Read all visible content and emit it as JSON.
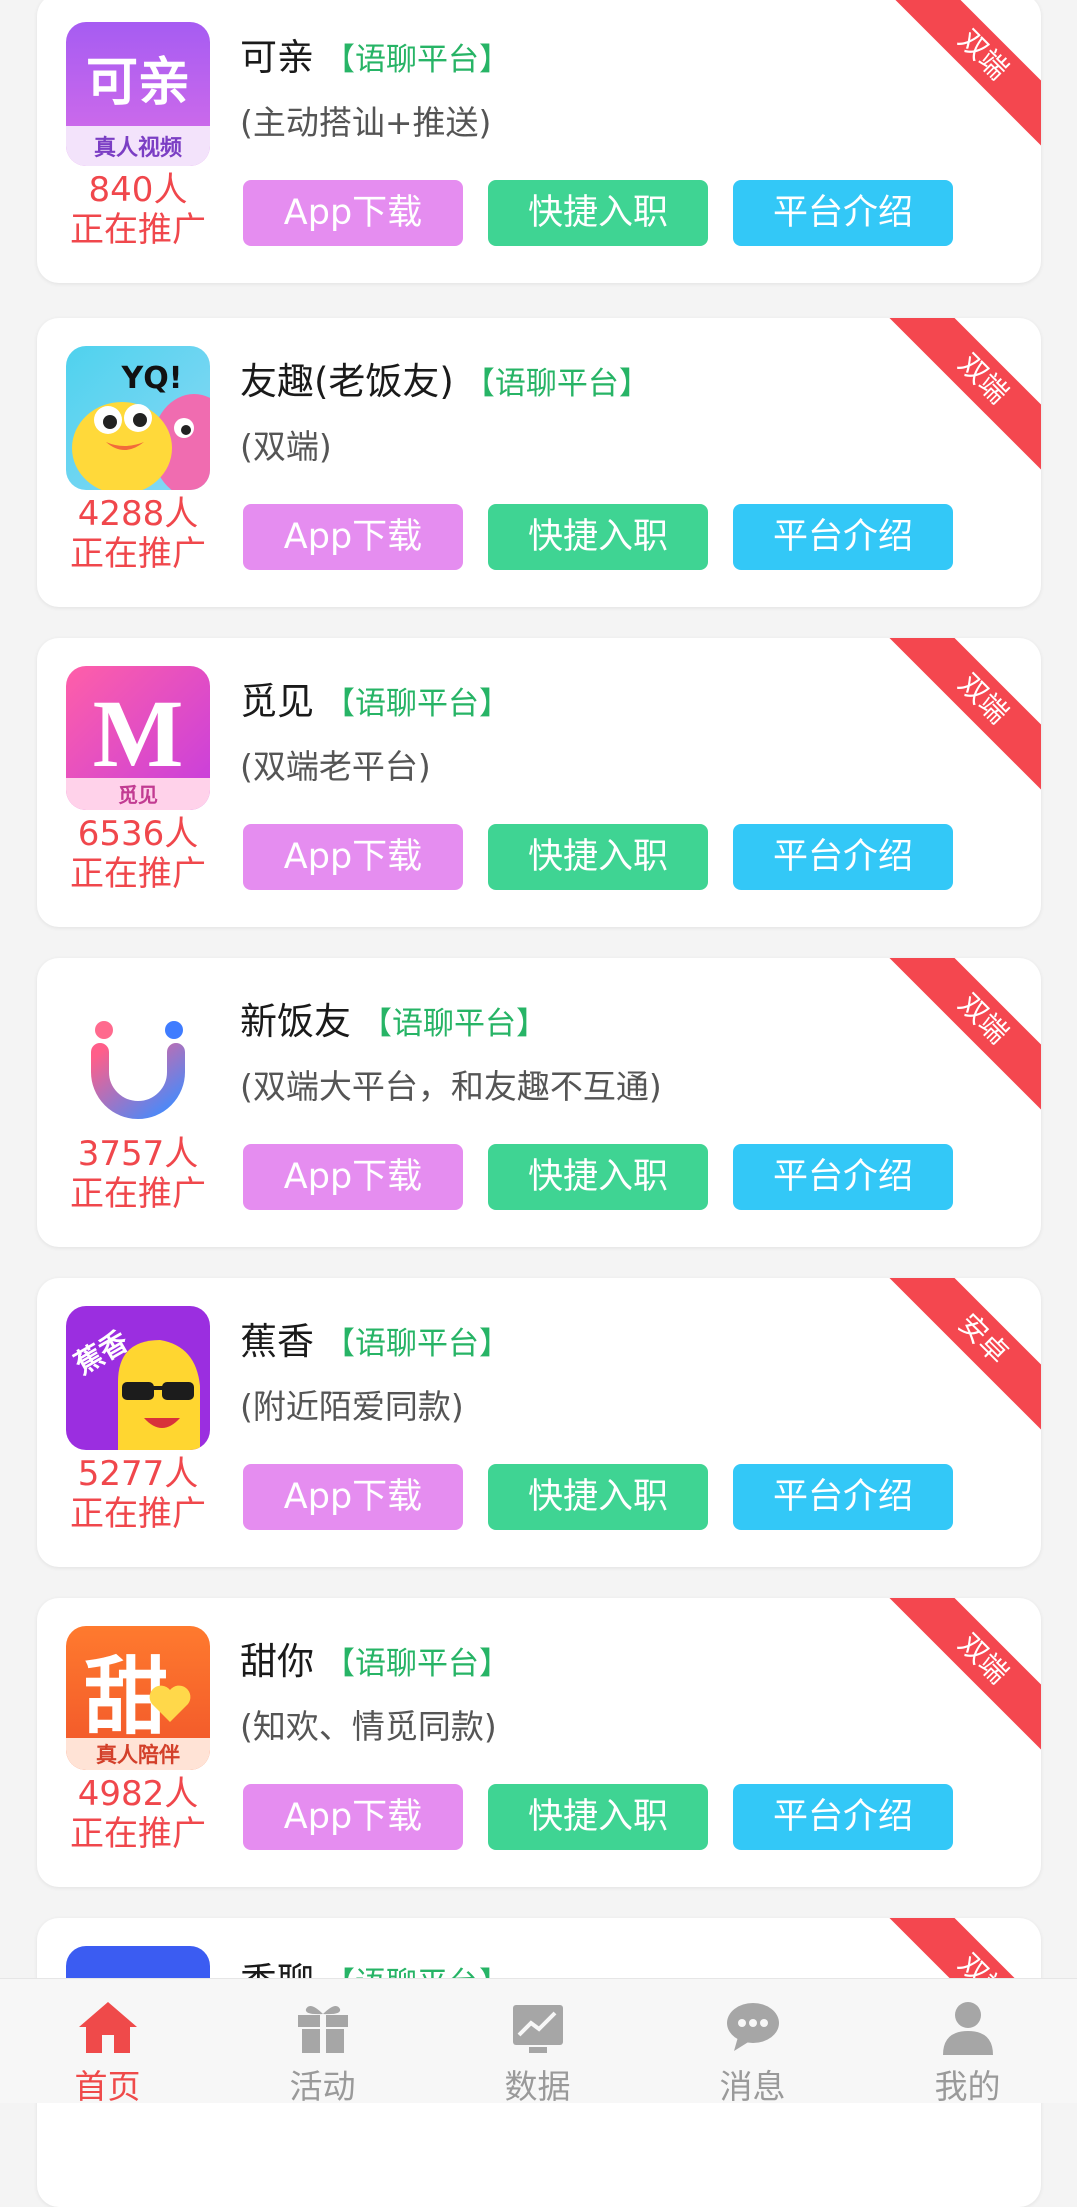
{
  "apps": [
    {
      "name": "可亲",
      "tag": "【语聊平台】",
      "desc": "(主动搭讪+推送)",
      "count": "840人",
      "promo": "正在推广",
      "ribbon": "双端",
      "logo": "keqin-logo",
      "logo_text": "可亲",
      "logo_sub": "真人视频"
    },
    {
      "name": "友趣(老饭友)",
      "tag": "【语聊平台】",
      "desc": "(双端)",
      "count": "4288人",
      "promo": "正在推广",
      "ribbon": "双端",
      "logo": "youqu-logo",
      "logo_text": "YQ!",
      "logo_sub": ""
    },
    {
      "name": "觅见",
      "tag": "【语聊平台】",
      "desc": "(双端老平台)",
      "count": "6536人",
      "promo": "正在推广",
      "ribbon": "双端",
      "logo": "mijian-logo",
      "logo_text": "M",
      "logo_sub": "觅见"
    },
    {
      "name": "新饭友",
      "tag": "【语聊平台】",
      "desc": "(双端大平台，和友趣不互通)",
      "count": "3757人",
      "promo": "正在推广",
      "ribbon": "双端",
      "logo": "xinfanyou-logo",
      "logo_text": "",
      "logo_sub": ""
    },
    {
      "name": "蕉香",
      "tag": "【语聊平台】",
      "desc": "(附近陌爱同款)",
      "count": "5277人",
      "promo": "正在推广",
      "ribbon": "安卓",
      "logo": "jiaoxiang-logo",
      "logo_text": "蕉香",
      "logo_sub": ""
    },
    {
      "name": "甜你",
      "tag": "【语聊平台】",
      "desc": "(知欢、情觅同款)",
      "count": "4982人",
      "promo": "正在推广",
      "ribbon": "双端",
      "logo": "tianni-logo",
      "logo_text": "甜",
      "logo_sub": "真人陪伴"
    },
    {
      "name": "秀聊",
      "tag": "【语聊平台】",
      "desc": "",
      "count": "",
      "promo": "",
      "ribbon": "双端",
      "logo": "partial-logo",
      "logo_text": "",
      "logo_sub": ""
    }
  ],
  "buttons": {
    "download": "App下载",
    "join": "快捷入职",
    "intro": "平台介绍"
  },
  "tabs": [
    {
      "label": "首页",
      "icon": "home-icon",
      "active": true
    },
    {
      "label": "活动",
      "icon": "gift-icon",
      "active": false
    },
    {
      "label": "数据",
      "icon": "chart-icon",
      "active": false
    },
    {
      "label": "消息",
      "icon": "message-icon",
      "active": false
    },
    {
      "label": "我的",
      "icon": "user-icon",
      "active": false
    }
  ],
  "colors": {
    "accent": "#ef4a4a",
    "download": "#e58df0",
    "join": "#3fd493",
    "intro": "#33c8f7",
    "tag": "#27b466"
  }
}
